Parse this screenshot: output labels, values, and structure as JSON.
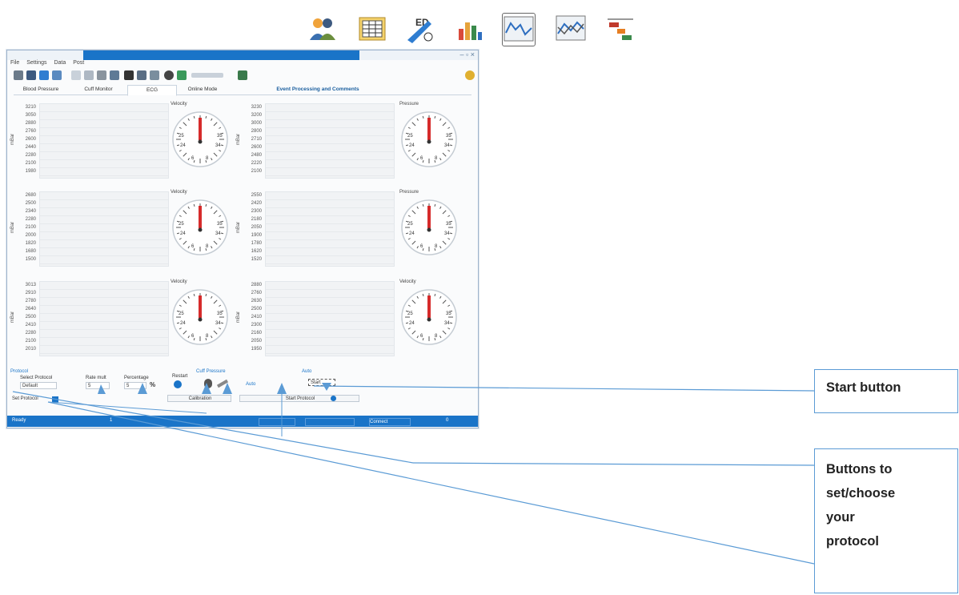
{
  "top_icons": [
    "users-icon",
    "spreadsheet-icon",
    "edit-ed-icon",
    "bar-chart-icon",
    "line-chart-icon",
    "multi-line-chart-icon",
    "timeline-icon"
  ],
  "window": {
    "menu": [
      "File",
      "Settings",
      "Data",
      "Post"
    ],
    "tabs": [
      "Blood Pressure",
      "Cuff Monitor",
      "ECG",
      "Online Mode",
      "Event Processing and Comments"
    ],
    "gauge_labels": [
      "Velocity",
      "Pressure",
      "Velocity",
      "Pressure",
      "Velocity",
      "Velocity"
    ],
    "gauge_ticks_left": [
      "3",
      "25",
      "24",
      "6"
    ],
    "gauge_ticks_right": [
      "5",
      "35",
      "34",
      "8"
    ],
    "ytick_sets": [
      [
        "3210",
        "3050",
        "2880",
        "2760",
        "2600",
        "2440",
        "2280",
        "2100",
        "1980"
      ],
      [
        "3230",
        "3200",
        "3000",
        "2800",
        "2710",
        "2600",
        "2480",
        "2220",
        "2100"
      ],
      [
        "2680",
        "2500",
        "2340",
        "2280",
        "2100",
        "2000",
        "1820",
        "1680",
        "1500"
      ],
      [
        "2550",
        "2420",
        "2300",
        "2180",
        "2050",
        "1900",
        "1780",
        "1620",
        "1520"
      ],
      [
        "3013",
        "2910",
        "2780",
        "2640",
        "2500",
        "2410",
        "2280",
        "2100",
        "2010"
      ],
      [
        "2880",
        "2760",
        "2630",
        "2500",
        "2410",
        "2300",
        "2160",
        "2050",
        "1950"
      ]
    ],
    "ylabel": "mBar",
    "controls": {
      "group1": "Protocol",
      "group2": "Cuff Pressure",
      "group3": "Auto",
      "protocol_label": "Select Protocol",
      "protocol_value": "Default",
      "rate_label": "Rate mult",
      "rate_value": "5",
      "percentage_label": "Percentage",
      "percentage_value": "5",
      "percent_sign": "%",
      "restart_label": "Restart",
      "auto_value": "Auto",
      "start_label": "Start",
      "button1": "Calibration",
      "button2": "Start Protocol",
      "select_label": "Set Protocol",
      "status_left": "Ready",
      "status_mid1": "1",
      "status_mid2": "Connect",
      "status_right": "0"
    }
  },
  "callouts": {
    "start": "Start button",
    "protocol_lines": [
      "Buttons to",
      "set/choose",
      "your",
      "protocol"
    ]
  },
  "colors": {
    "accent": "#1a74c8",
    "callout_border": "#5b9bd5",
    "gauge_needle": "#d62b2b"
  }
}
